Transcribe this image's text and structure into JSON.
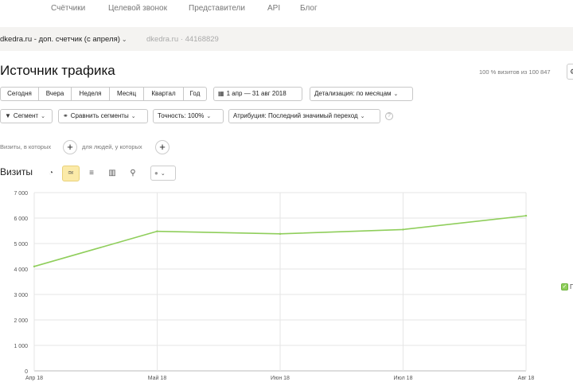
{
  "nav": {
    "items": [
      "Счётчики",
      "Целевой звонок",
      "Представители",
      "API",
      "Блог"
    ]
  },
  "counter": {
    "name": "dkedra.ru - доп. счетчик (с апреля)",
    "chevron": "⌄",
    "site_and_id": "dkedra.ru · 44168829"
  },
  "report": {
    "title": "Источник трафика",
    "sample_text": "100 % визитов из 100 847",
    "sample_button": "⚙"
  },
  "period_buttons": [
    "Сегодня",
    "Вчера",
    "Неделя",
    "Месяц",
    "Квартал",
    "Год"
  ],
  "date_range": {
    "icon": "calendar-icon",
    "label": "1 апр — 31 авг 2018"
  },
  "detail": {
    "label": "Детализация: по месяцам"
  },
  "segment_bar": {
    "segment": "Сегмент",
    "compare": "Сравнить сегменты",
    "accuracy": "Точность: 100%",
    "attribution": "Атрибуция: Последний значимый переход",
    "help": "?"
  },
  "filters": {
    "visits_label": "Визиты, в которых",
    "people_label": "для людей, у которых",
    "plus": "+"
  },
  "chart_header": {
    "title": "Визиты",
    "tools": [
      "pie-chart-icon",
      "line-chart-icon",
      "stacked-area-icon",
      "bar-chart-icon",
      "map-pin-icon"
    ],
    "active_tool": 1,
    "comment_icon": "speech-bubble-icon"
  },
  "legend": {
    "check": "✓",
    "label": "П"
  },
  "colors": {
    "series": "#8fce5b",
    "active_tool": "#fbeaa8",
    "grid": "#e6e6e6"
  },
  "chart_data": {
    "type": "line",
    "categories": [
      "Апр 18",
      "Май 18",
      "Июн 18",
      "Июл 18",
      "Авг 18"
    ],
    "series": [
      {
        "values": [
          4100,
          5480,
          5380,
          5550,
          6090
        ]
      }
    ],
    "yticks": [
      "7 000",
      "6 000",
      "5 000",
      "4 000",
      "3 000",
      "2 000",
      "1 000",
      "0"
    ],
    "ylim": [
      0,
      7000
    ],
    "xlabel": "",
    "ylabel": "",
    "grid": true
  }
}
